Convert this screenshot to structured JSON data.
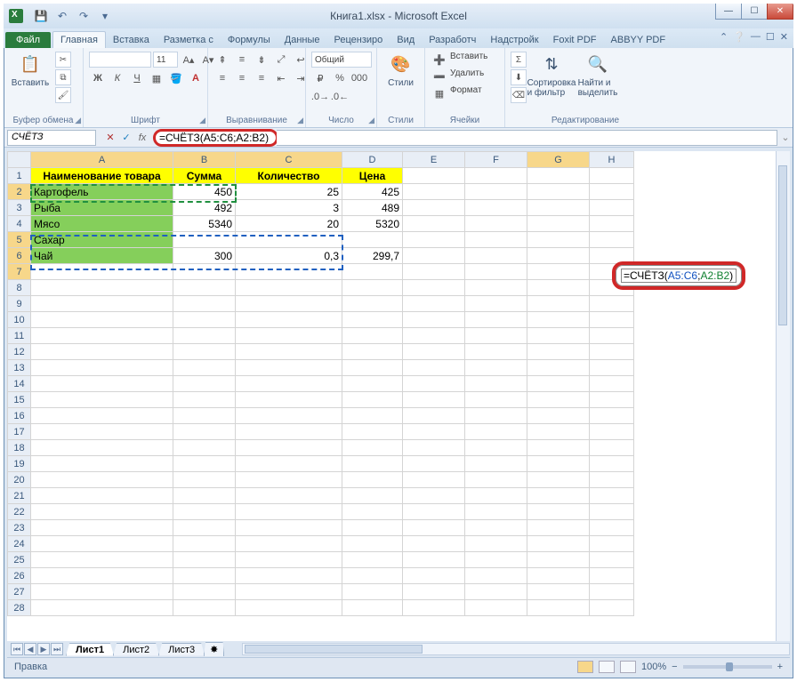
{
  "title": "Книга1.xlsx - Microsoft Excel",
  "tabs": {
    "file": "Файл",
    "home": "Главная",
    "insert": "Вставка",
    "layout": "Разметка с",
    "formulas": "Формулы",
    "data": "Данные",
    "review": "Рецензиро",
    "view": "Вид",
    "developer": "Разработч",
    "addins": "Надстройк",
    "foxit": "Foxit PDF",
    "abbyy": "ABBYY PDF"
  },
  "ribbon": {
    "paste": "Вставить",
    "clipboard": "Буфер обмена",
    "font_name": "",
    "font_size": "11",
    "font": "Шрифт",
    "alignment": "Выравнивание",
    "number_format": "Общий",
    "number": "Число",
    "styles_btn": "Стили",
    "styles": "Стили",
    "insert_cells": "Вставить",
    "delete_cells": "Удалить",
    "format_cells": "Формат",
    "cells": "Ячейки",
    "sort_filter": "Сортировка\nи фильтр",
    "find_select": "Найти и\nвыделить",
    "editing": "Редактирование"
  },
  "namebox": "СЧЁТЗ",
  "formula": "=СЧЁТЗ(A5:C6;A2:B2)",
  "cell_formula_prefix": "=СЧЁТЗ(",
  "cell_formula_r1": "A5:C6",
  "cell_formula_sep": ";",
  "cell_formula_r2": "A2:B2",
  "cell_formula_suffix": ")",
  "cols": [
    "A",
    "B",
    "C",
    "D",
    "E",
    "F",
    "G",
    "H"
  ],
  "rownums": [
    "1",
    "2",
    "3",
    "4",
    "5",
    "6",
    "7",
    "8",
    "9",
    "10",
    "11",
    "12",
    "13",
    "14",
    "15",
    "16",
    "17",
    "18",
    "19",
    "20",
    "21",
    "22",
    "23",
    "24",
    "25",
    "26",
    "27",
    "28"
  ],
  "headers": {
    "a": "Наименование товара",
    "b": "Сумма",
    "c": "Количество",
    "d": "Цена"
  },
  "data_rows": [
    {
      "a": "Картофель",
      "b": "450",
      "c": "25",
      "d": "425"
    },
    {
      "a": "Рыба",
      "b": "492",
      "c": "3",
      "d": "489"
    },
    {
      "a": "Мясо",
      "b": "5340",
      "c": "20",
      "d": "5320"
    },
    {
      "a": "Сахар",
      "b": "",
      "c": "",
      "d": ""
    },
    {
      "a": "Чай",
      "b": "300",
      "c": "0,3",
      "d": "299,7"
    }
  ],
  "sheets": {
    "s1": "Лист1",
    "s2": "Лист2",
    "s3": "Лист3"
  },
  "status": "Правка",
  "zoom": "100%"
}
